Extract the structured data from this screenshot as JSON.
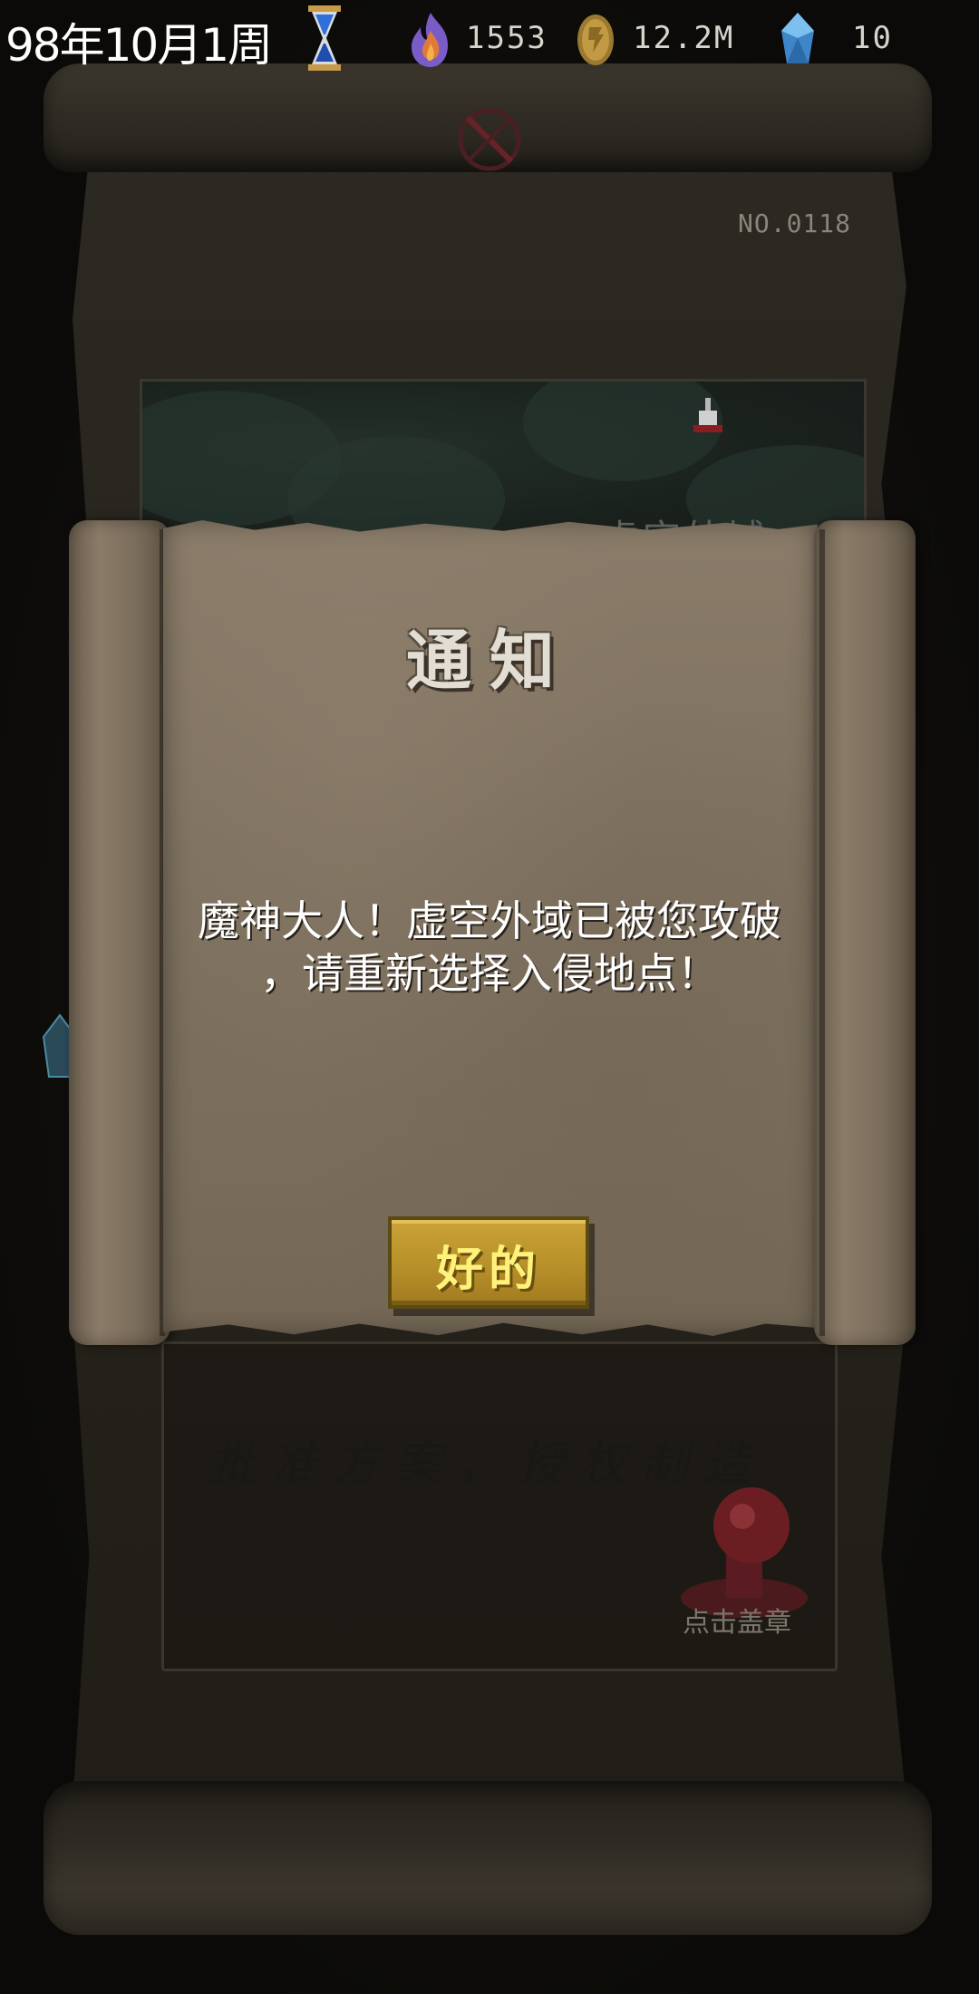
{
  "status_bar": {
    "date": "98年10月1周",
    "resources": [
      {
        "icon": "purple-flame-icon",
        "value": "1553",
        "color": "#8a6bd8"
      },
      {
        "icon": "gold-coin-icon",
        "value": "12.2M",
        "color": "#b8923a"
      },
      {
        "icon": "blue-crystal-icon",
        "value": "10",
        "color": "#5fa8e0"
      }
    ]
  },
  "background": {
    "doc_number": "NO.0118",
    "map_region_label": "虚空外域",
    "approval_text": "批准方案，授权制造",
    "stamp_label": "点击盖章"
  },
  "dialog": {
    "title": "通知",
    "message": "魔神大人！虚空外域已被您攻破\n，请重新选择入侵地点！",
    "ok_label": "好的",
    "button_color": "#b8902a",
    "button_text_color": "#fff27a"
  }
}
